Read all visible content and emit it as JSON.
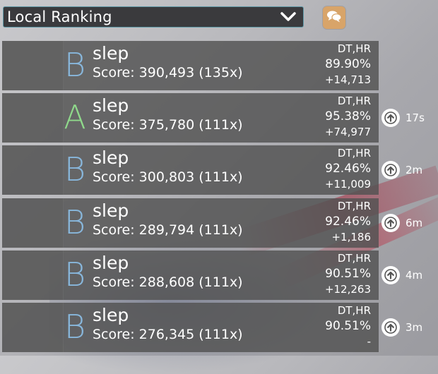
{
  "header": {
    "dropdown_label": "Local Ranking"
  },
  "rows": [
    {
      "grade": "B",
      "name": "slep",
      "score": "Score: 390,493 (135x)",
      "mods": "DT,HR",
      "accuracy": "89.90%",
      "diff": "+14,713",
      "time": ""
    },
    {
      "grade": "A",
      "name": "slep",
      "score": "Score: 375,780 (111x)",
      "mods": "DT,HR",
      "accuracy": "95.38%",
      "diff": "+74,977",
      "time": "17s"
    },
    {
      "grade": "B",
      "name": "slep",
      "score": "Score: 300,803 (111x)",
      "mods": "DT,HR",
      "accuracy": "92.46%",
      "diff": "+11,009",
      "time": "2m"
    },
    {
      "grade": "B",
      "name": "slep",
      "score": "Score: 289,794 (111x)",
      "mods": "DT,HR",
      "accuracy": "92.46%",
      "diff": "+1,186",
      "time": "6m"
    },
    {
      "grade": "B",
      "name": "slep",
      "score": "Score: 288,608 (111x)",
      "mods": "DT,HR",
      "accuracy": "90.51%",
      "diff": "+12,263",
      "time": "4m"
    },
    {
      "grade": "B",
      "name": "slep",
      "score": "Score: 276,345 (111x)",
      "mods": "DT,HR",
      "accuracy": "90.51%",
      "diff": "-",
      "time": "3m"
    }
  ],
  "colors": {
    "grade_A": "#8fd98b",
    "grade_B": "#88b7dc",
    "chat_button": "#d8a469",
    "dropdown_border": "#5f9aa8"
  },
  "icons": {
    "dropdown_chevron": "chevron-down-icon",
    "chat": "chat-bubbles-icon",
    "upgrade": "arrow-up-circle-icon"
  }
}
